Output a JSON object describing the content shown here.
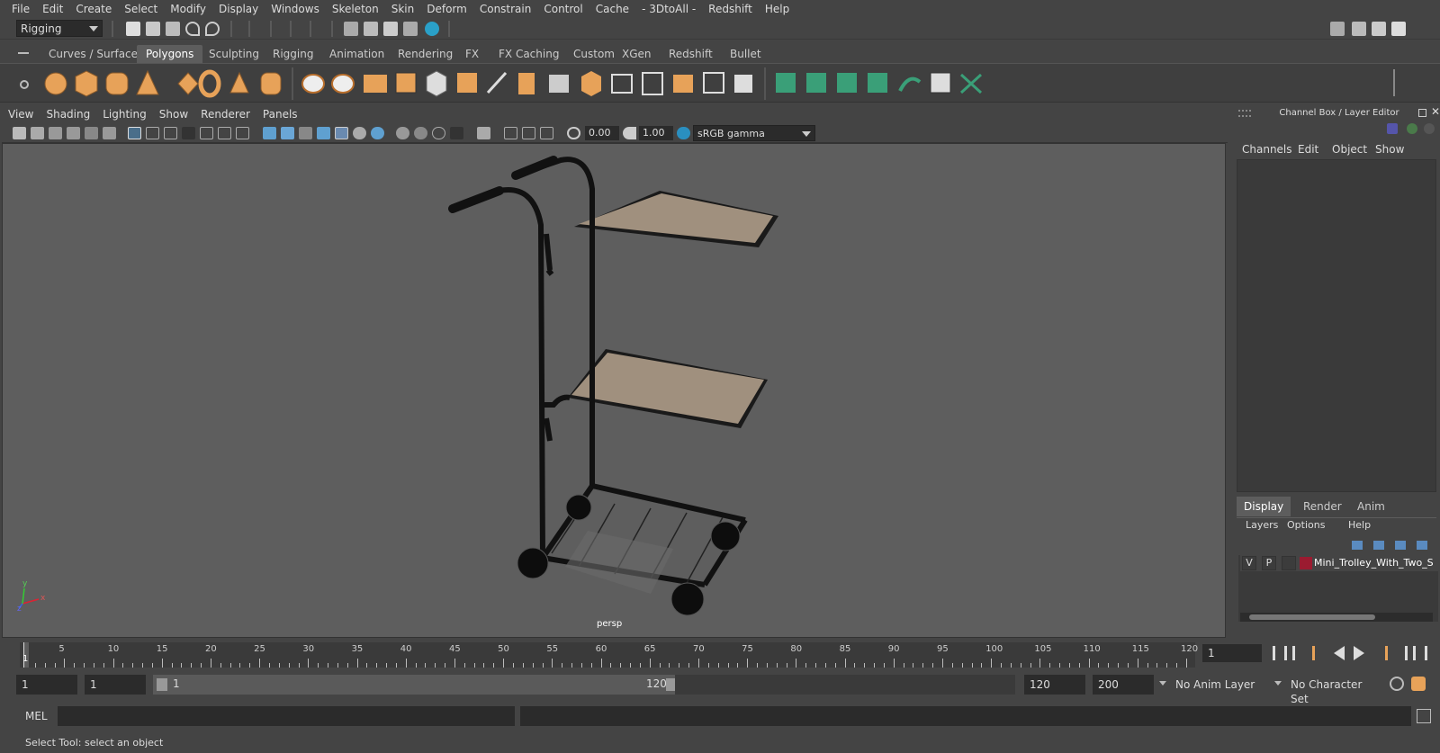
{
  "menubar": {
    "items": [
      "File",
      "Edit",
      "Create",
      "Select",
      "Modify",
      "Display",
      "Windows",
      "Skeleton",
      "Skin",
      "Deform",
      "Constrain",
      "Control",
      "Cache",
      "- 3DtoAll -",
      "Redshift",
      "Help"
    ]
  },
  "statusline": {
    "mode_dropdown": "Rigging"
  },
  "shelf": {
    "tabs": [
      "Curves / Surfaces",
      "Polygons",
      "Sculpting",
      "Rigging",
      "Animation",
      "Rendering",
      "FX",
      "FX Caching",
      "Custom",
      "XGen",
      "Redshift",
      "Bullet"
    ],
    "active_tab": "Polygons"
  },
  "viewport": {
    "menu": [
      "View",
      "Shading",
      "Lighting",
      "Show",
      "Renderer",
      "Panels"
    ],
    "exposure": "0.00",
    "gamma": "1.00",
    "color_space": "sRGB gamma",
    "camera_label": "persp",
    "axis": {
      "x": "x",
      "y": "y",
      "z": "z"
    }
  },
  "channel_box": {
    "title": "Channel Box / Layer Editor",
    "menu": [
      "Channels",
      "Edit",
      "Object",
      "Show"
    ]
  },
  "layer_editor": {
    "tabs": [
      "Display",
      "Render",
      "Anim"
    ],
    "active_tab": "Display",
    "menu": [
      "Layers",
      "Options",
      "Help"
    ],
    "layers": [
      {
        "visible": "V",
        "playback": "P",
        "color": "#9b1b30",
        "name": "Mini_Trolley_With_Two_S"
      }
    ]
  },
  "timeslider": {
    "ticks": [
      1,
      5,
      10,
      15,
      20,
      25,
      30,
      35,
      40,
      45,
      50,
      55,
      60,
      65,
      70,
      75,
      80,
      85,
      90,
      95,
      100,
      105,
      110,
      115,
      120
    ],
    "current_frame": "1",
    "current_frame_field": "1"
  },
  "range": {
    "start_frame": "1",
    "playback_start": "1",
    "range_start_label": "1",
    "range_end_label": "120",
    "playback_end": "120",
    "end_frame": "200",
    "anim_layer": "No Anim Layer",
    "character_set": "No Character Set"
  },
  "command": {
    "language": "MEL"
  },
  "help": {
    "text": "Select Tool: select an object"
  }
}
